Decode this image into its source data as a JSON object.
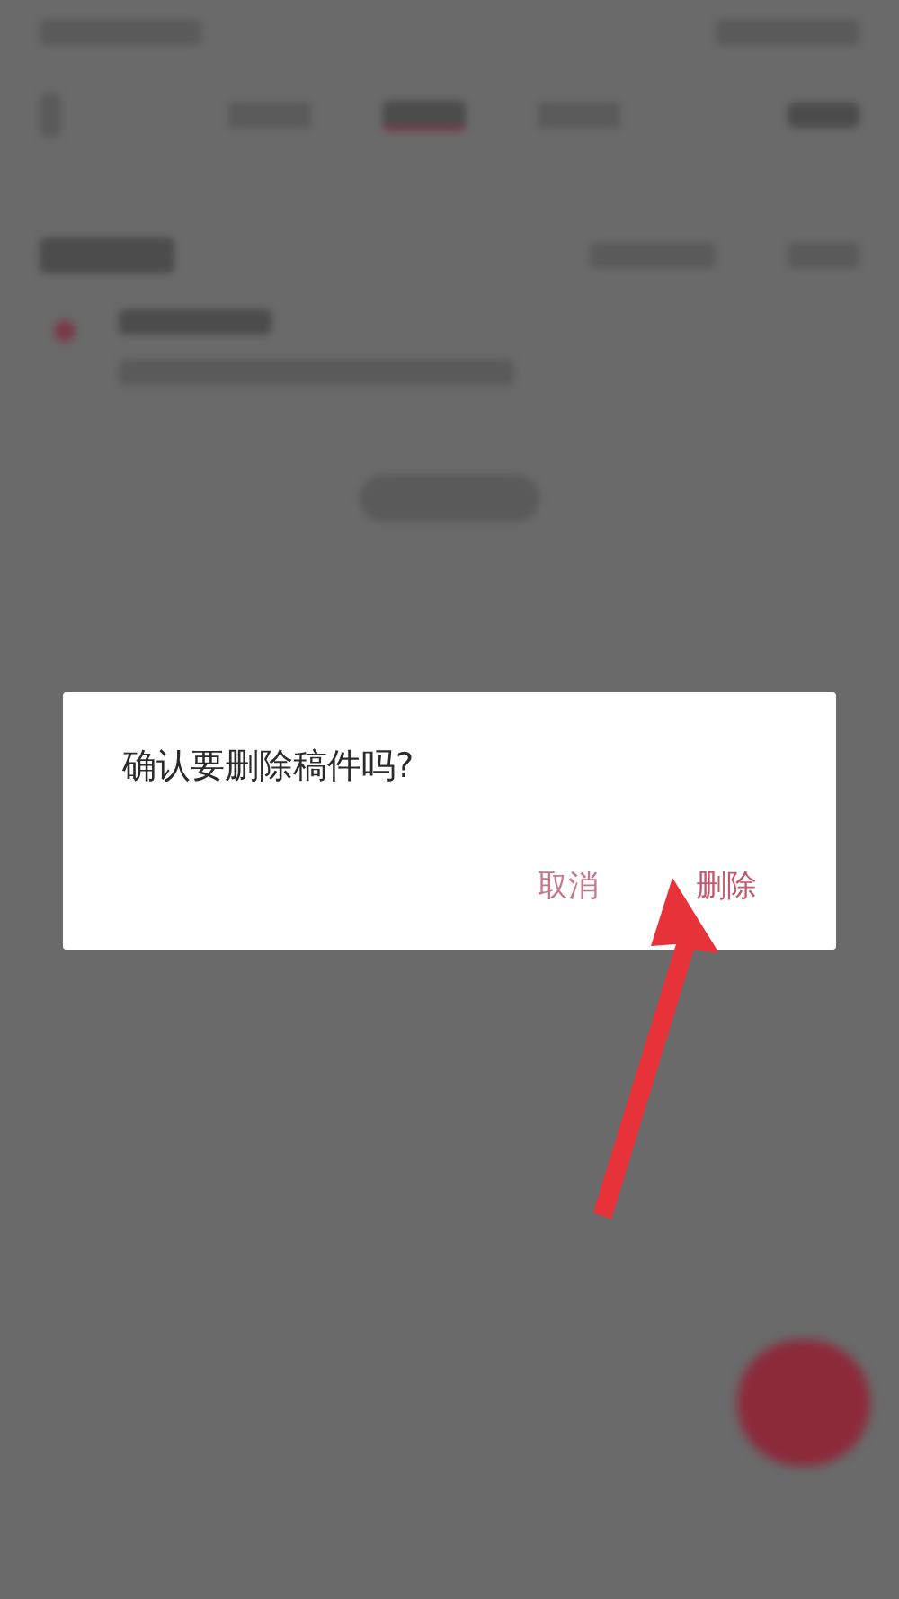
{
  "dialog": {
    "message": "确认要删除稿件吗?",
    "buttons": [
      {
        "label": "取消",
        "kind": "cancel"
      },
      {
        "label": "删除",
        "kind": "confirm"
      }
    ]
  },
  "callout": {
    "kind": "arrow"
  },
  "tabs": [
    {
      "selected": false
    },
    {
      "selected": true
    },
    {
      "selected": false
    }
  ]
}
